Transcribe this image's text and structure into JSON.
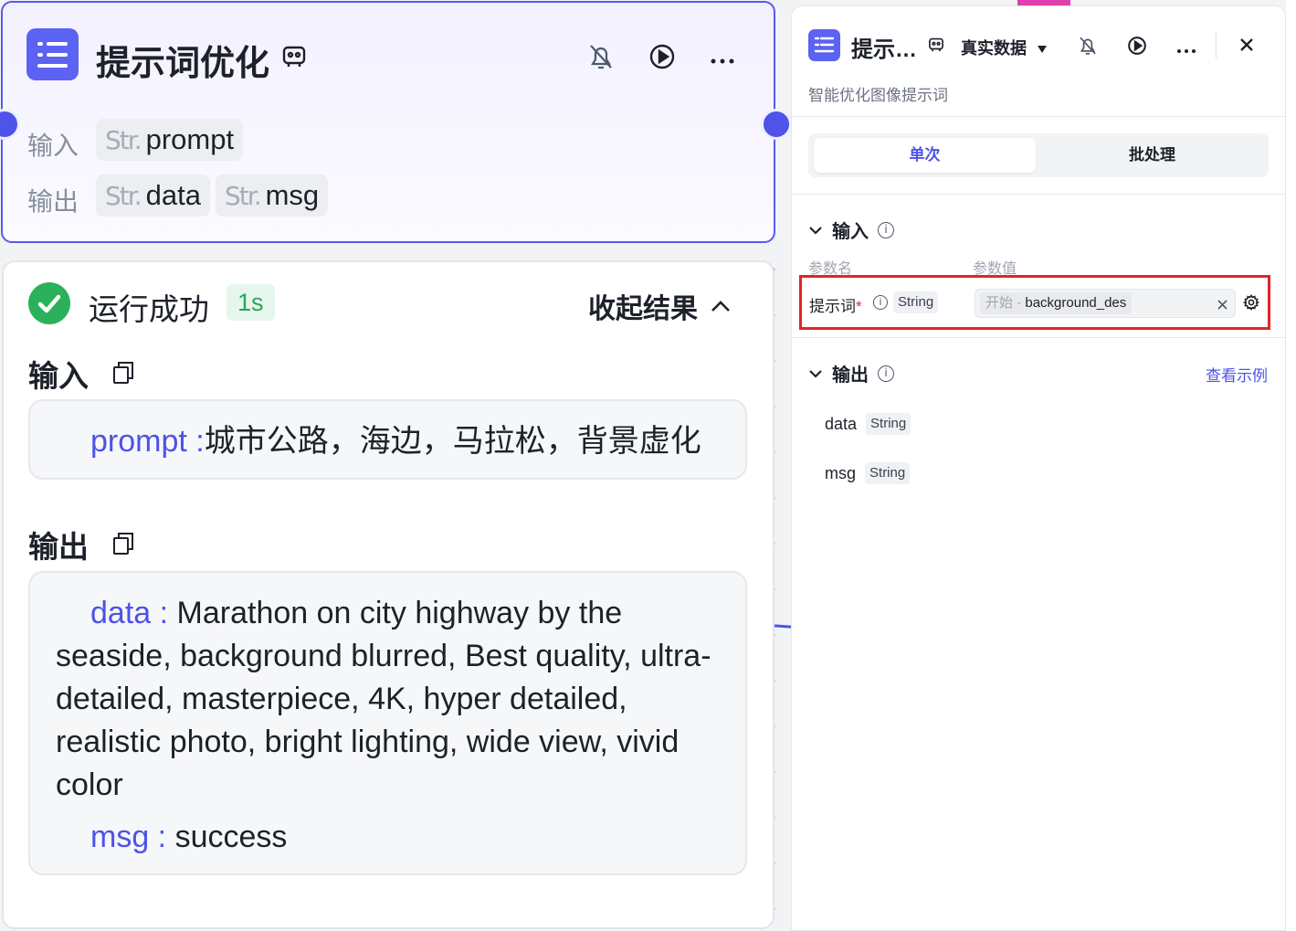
{
  "node": {
    "title": "提示词优化",
    "input_label": "输入",
    "output_label": "输出",
    "type_prefix": "Str.",
    "inputs": [
      "prompt"
    ],
    "outputs": [
      "data",
      "msg"
    ]
  },
  "result": {
    "status": "运行成功",
    "duration": "1s",
    "collapse_label": "收起结果",
    "input_heading": "输入",
    "output_heading": "输出",
    "input_key": "prompt :",
    "input_value": "城市公路，海边，马拉松，背景虚化",
    "data_key": "data :",
    "data_value": "Marathon on city highway by the seaside, background blurred, Best quality, ultra-detailed, masterpiece, 4K, hyper detailed, realistic photo, bright lighting, wide view, vivid color",
    "msg_key": "msg :",
    "msg_value": "success"
  },
  "panel": {
    "title": "提示…",
    "data_mode": "真实数据",
    "subtitle": "智能优化图像提示词",
    "tabs": [
      "单次",
      "批处理"
    ],
    "input_section": "输入",
    "col_param_name": "参数名",
    "col_param_value": "参数值",
    "param_name": "提示词",
    "required_mark": "*",
    "param_type": "String",
    "ref_source": "开始",
    "ref_sep": "-",
    "ref_var": "background_des",
    "output_section": "输出",
    "view_example": "查看示例",
    "outputs": [
      {
        "name": "data",
        "type": "String"
      },
      {
        "name": "msg",
        "type": "String"
      }
    ]
  },
  "colors": {
    "accent": "#4d53e8",
    "success": "#2bb159",
    "highlight_border": "#e3232b"
  },
  "icons": [
    "list-icon",
    "snapshot-icon",
    "mute-icon",
    "play-icon",
    "more-icon",
    "check-icon",
    "chevron-up-icon",
    "copy-icon",
    "caret-down-icon",
    "close-icon",
    "info-icon",
    "clear-icon",
    "settings-icon",
    "chevron-down-icon"
  ]
}
